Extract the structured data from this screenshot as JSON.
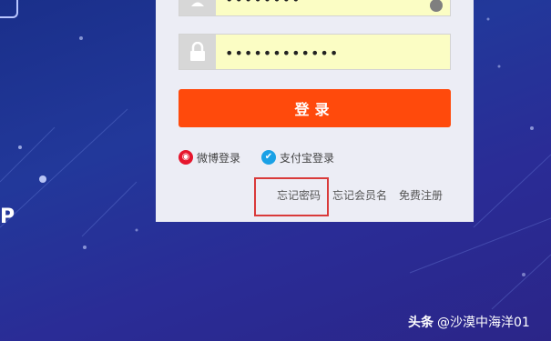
{
  "login": {
    "username_value": "••••••••",
    "password_value": "••••••••••••",
    "login_button_label": "登录"
  },
  "social": {
    "weibo_label": "微博登录",
    "alipay_label": "支付宝登录"
  },
  "links": {
    "forgot_password": "忘记密码",
    "forgot_member_name": "忘记会员名",
    "register": "免费注册"
  },
  "background": {
    "logo_fragment": "P"
  },
  "watermark": {
    "brand": "头条",
    "handle": "@沙漠中海洋01"
  },
  "icons": {
    "user": "user-icon",
    "lock": "lock-icon",
    "weibo": "weibo-icon",
    "alipay": "alipay-icon",
    "clear": "clear-icon"
  },
  "colors": {
    "login_button": "#ff4a0c",
    "input_bg": "#fbfdc4",
    "panel_bg": "#ecedf5",
    "highlight": "#d93a3a",
    "background": "#22389a"
  }
}
